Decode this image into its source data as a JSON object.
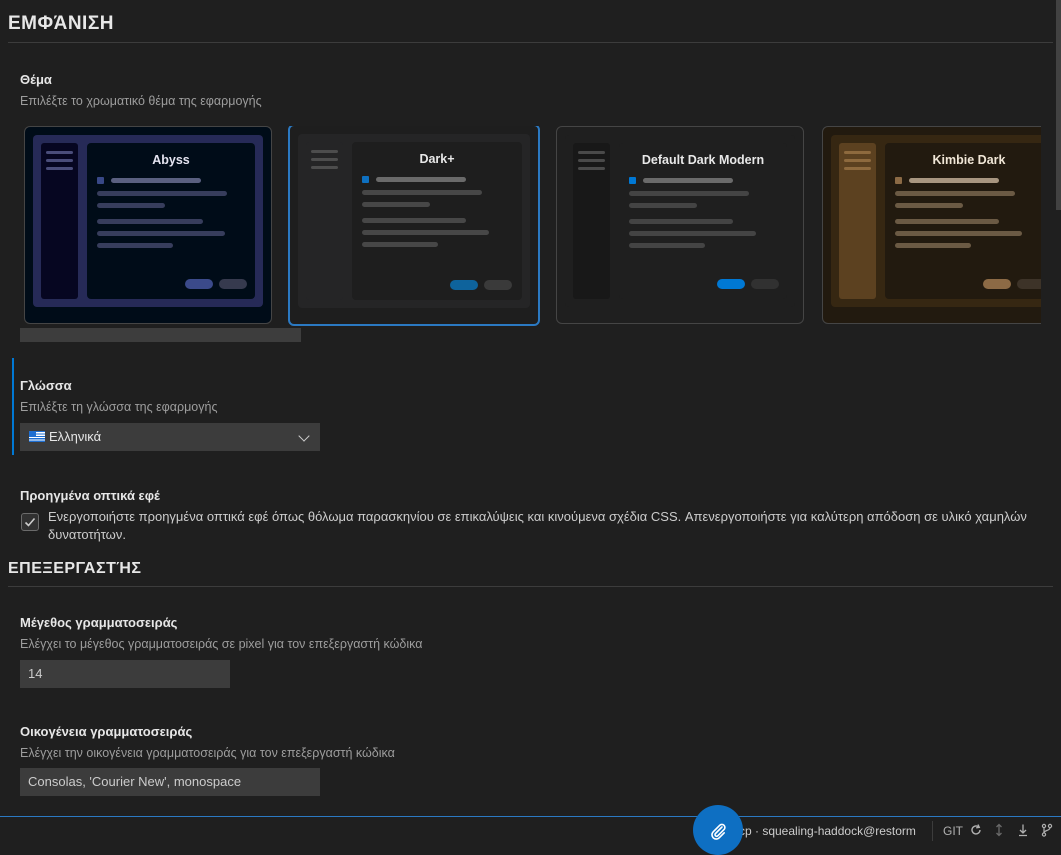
{
  "appearance": {
    "header": "ΕΜΦΆΝΙΣΗ",
    "theme": {
      "title": "Θέμα",
      "description": "Επιλέξτε το χρωματικό θέμα της εφαρμογής",
      "selected": "Dark+",
      "cards": [
        {
          "name": "Abyss",
          "selected": false
        },
        {
          "name": "Dark+",
          "selected": true
        },
        {
          "name": "Default Dark Modern",
          "selected": false
        },
        {
          "name": "Kimbie Dark",
          "selected": false
        }
      ]
    },
    "language": {
      "title": "Γλώσσα",
      "description": "Επιλέξτε τη γλώσσα της εφαρμογής",
      "selected_value": "Ελληνικά"
    },
    "effects": {
      "title": "Προηγμένα οπτικά εφέ",
      "checked": true,
      "label": "Ενεργοποιήστε προηγμένα οπτικά εφέ όπως θόλωμα παρασκηνίου σε επικαλύψεις και κινούμενα σχέδια CSS. Απενεργοποιήστε για καλύτερη απόδοση σε υλικό χαμηλών δυνατοτήτων."
    }
  },
  "editor": {
    "header": "ΕΠΕΞΕΡΓΑΣΤΉΣ",
    "font_size": {
      "title": "Μέγεθος γραμματοσειράς",
      "description": "Ελέγχει το μέγεθος γραμματοσειράς σε pixel για τον επεξεργαστή κώδικα",
      "value": "14"
    },
    "font_family": {
      "title": "Οικογένεια γραμματοσειράς",
      "description": "Ελέγχει την οικογένεια γραμματοσειράς για τον επεξεργαστή κώδικα",
      "value": "Consolas, 'Courier New', monospace"
    }
  },
  "statusbar": {
    "connection": "mcp · squealing-haddock@restorm",
    "git_label": "GIT",
    "icons": [
      "refresh-icon",
      "arrows-updown-icon",
      "download-icon",
      "branch-icon"
    ],
    "fab_icon": "paperclip-icon"
  },
  "colors": {
    "accent": "#0078d4",
    "selected_border": "#2b79c2",
    "background": "#1f1f1f"
  }
}
